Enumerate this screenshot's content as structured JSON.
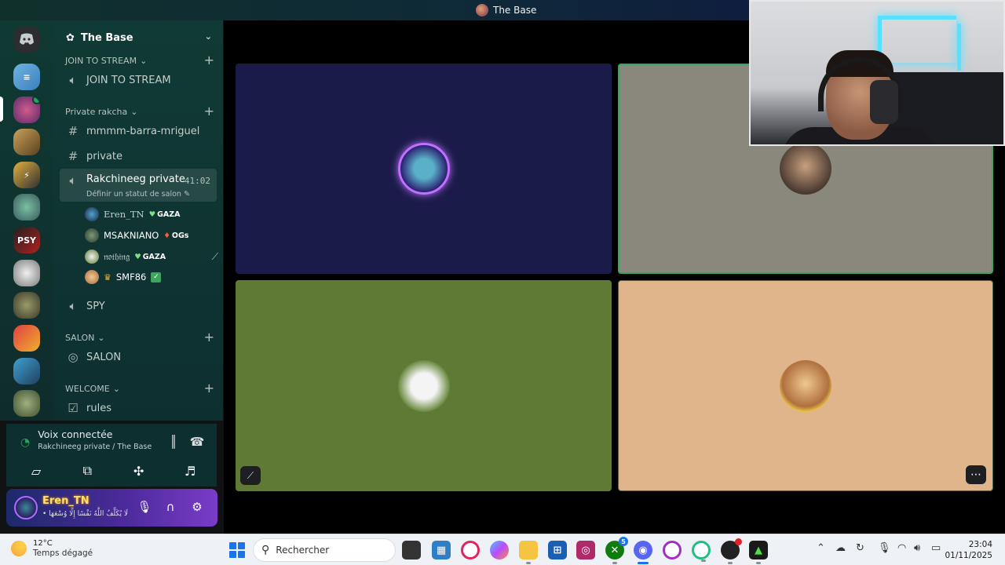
{
  "window": {
    "title": "The Base"
  },
  "server": {
    "name": "The Base",
    "categories": [
      {
        "label": "JOIN TO STREAM",
        "channels": [
          "JOIN TO STREAM"
        ]
      },
      {
        "label": "Private rakcha",
        "channels": [
          "mmmm-barra-mriguel",
          "private",
          "Rakchineeg private",
          "SPY"
        ]
      },
      {
        "label": "SALON",
        "channels": [
          "SALON"
        ]
      },
      {
        "label": "WELCOME",
        "channels": [
          "rules"
        ]
      }
    ],
    "active_channel": {
      "name": "Rakchineeg private",
      "timer": "41:02",
      "status_prompt": "Définir un statut de salon"
    },
    "members": [
      {
        "name": "Eren_TN",
        "tag": "GAZA"
      },
      {
        "name": "MSAKNIANO",
        "tag": "OGs"
      },
      {
        "name": "𝔫𝔬𝔱𝔥𝔦𝔫𝔤",
        "tag": "GAZA"
      },
      {
        "name": "SMF86",
        "tag": ""
      }
    ]
  },
  "voice": {
    "status": "Voix connectée",
    "location": "Rakchineeg private / The Base"
  },
  "user": {
    "name": "Eren_TN",
    "status": "• لَا يُكَلِّفُ اللَّهُ نَفْسًا إِلَّا وُسْعَهَا"
  },
  "taskbar": {
    "temp": "12°C",
    "weather": "Temps dégagé",
    "search_placeholder": "Rechercher",
    "time": "23:04",
    "date": "01/11/2025",
    "xbox_badge": "5"
  },
  "colors": {
    "tile_1": "#1b1b4a",
    "tile_2": "#8a877c",
    "tile_3": "#5e7a34",
    "tile_4": "#e0b58b",
    "speaking_border": "#3ba55d"
  }
}
